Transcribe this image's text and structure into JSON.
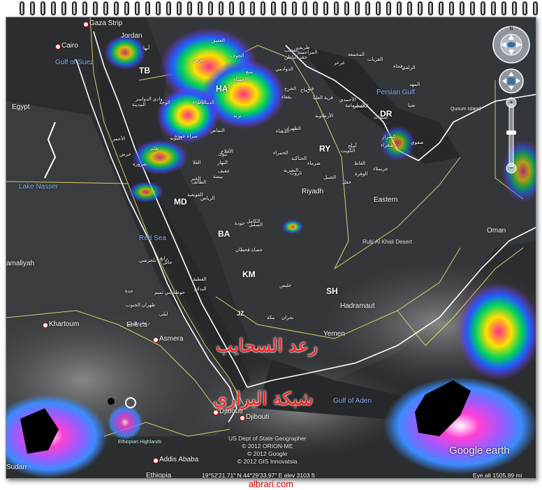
{
  "map": {
    "countries": [
      "Egypt",
      "Jordan",
      "Eritrea",
      "Ethiopia",
      "Yemen",
      "Oman",
      "Riyadh",
      "Eastern",
      "Hadramaut",
      "amaliyah"
    ],
    "water": [
      "Gulf of Suez",
      "Red Sea",
      "Persian Gulf",
      "Lake Nasser",
      "Gulf of Aden"
    ],
    "cities": [
      "Cairo",
      "Gaza Strip",
      "Khartoum",
      "Asmera",
      "Djibouti",
      "Djibouti",
      "Addis Ababa",
      "Qusum Island",
      "Sudan"
    ],
    "desert": "Rub' Al Khali Desert",
    "highlands": "Ethiopian Highlands",
    "radar_stations": [
      "TB",
      "HA",
      "DR",
      "RY",
      "MD",
      "BA",
      "KM",
      "SH",
      "JZ"
    ],
    "arabic_places": [
      "الرياض",
      "المدينة",
      "الطائف",
      "جدة",
      "تبوك",
      "حائل",
      "الجوف",
      "الدمام",
      "الاحساء",
      "بيشة",
      "أبها",
      "نجران",
      "شرورة",
      "الخرج",
      "القويعية",
      "تربة",
      "رنية",
      "الباحة",
      "النماص",
      "بلجرشي",
      "سراة عبيدة",
      "ظهران الجنوب",
      "حوطة بني تميم",
      "الدلم",
      "الأفلاج",
      "السليل",
      "وادي الدواسر",
      "حرض",
      "حرض",
      "جودة",
      "الظهران",
      "الخبر",
      "القطيف",
      "العلا",
      "الوجه",
      "ينبع",
      "رابغ",
      "مكة",
      "خليص",
      "الكامل",
      "العقيق",
      "المويه",
      "ظلم",
      "حصاة قحطان",
      "ليلى",
      "الأحمر",
      "النهار",
      "الدلم",
      "البدائع",
      "عفيف",
      "الحناكية",
      "المهد",
      "الدوادمي",
      "شقراء",
      "حريملاء",
      "ضرماء",
      "المزاحمية",
      "القصب",
      "الغاط",
      "الزلفي",
      "المجمعة",
      "الأرطاوية",
      "بقعاء",
      "قبة",
      "رفحاء",
      "طريف",
      "القريات",
      "عرعر",
      "السليمانية",
      "الحمراء",
      "الكويت",
      "الجبيل",
      "الصرار",
      "قرية العليا",
      "النعيرية",
      "حفر الباطن",
      "رماح",
      "الدهناء",
      "الأحمدي",
      "الوفرة",
      "الخفجي",
      "تاروت",
      "سيهات",
      "صفوى",
      "حقل",
      "ضبا",
      "أملج"
    ],
    "watermark_1": "رعد السحايب",
    "watermark_2": "شبكة البراري"
  },
  "credits": {
    "line1": "US Dept of State Geographer",
    "line2": "© 2012 ORION-ME",
    "line3": "© 2012 Google",
    "line4": "© 2012 GIS Innovatsia"
  },
  "status": {
    "coords": "19°52'21.71\" N  44°29'33.97\" E  elev  3103 ft",
    "eye_alt": "Eye alt  1505.89 mi"
  },
  "brand": {
    "logo": "Google earth",
    "site": "albrari.com"
  },
  "nav": {
    "north_label": "N"
  },
  "icons": [
    "compass-icon",
    "look-joystick-icon",
    "move-joystick-icon",
    "zoom-in-icon",
    "zoom-out-icon",
    "spiral-binding-icon"
  ]
}
